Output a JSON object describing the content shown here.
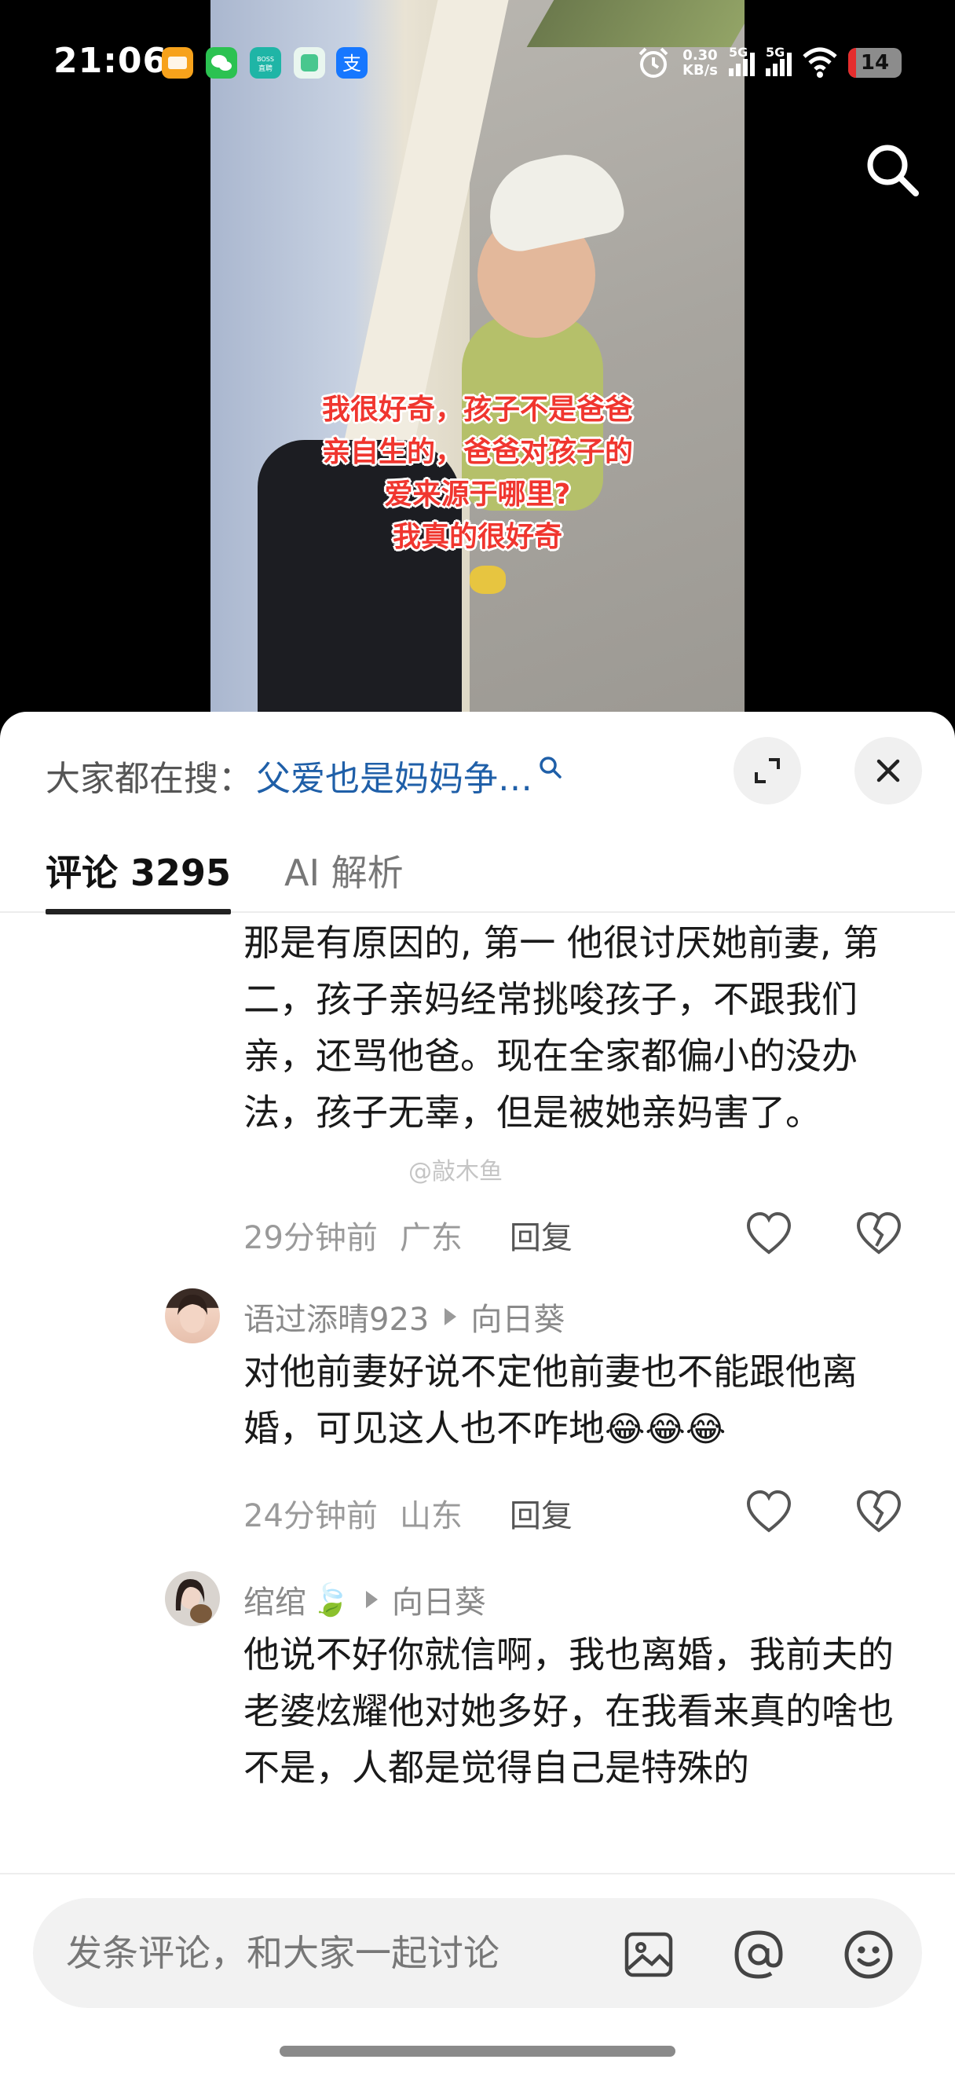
{
  "status_bar": {
    "time": "21:06",
    "net_speed_value": "0.30",
    "net_speed_unit": "KB/s",
    "signal_1_label": "5G",
    "signal_2_label": "5G",
    "battery": "14",
    "app_icons": [
      "orange-app-icon",
      "wechat-icon",
      "boss-zhipin-icon",
      "green-app-icon",
      "alipay-icon"
    ]
  },
  "video": {
    "overlay_lines": [
      "我很好奇，孩子不是爸爸",
      "亲自生的，爸爸对孩子的",
      "爱来源于哪里?",
      "我真的很好奇"
    ]
  },
  "hot_search": {
    "prefix": "大家都在搜：",
    "query": "父爱也是妈妈争…"
  },
  "tabs": {
    "comments": "评论 3295",
    "ai": "AI 解析"
  },
  "watermark": "@敲木鱼",
  "comments": [
    {
      "text": "那是有原因的, 第一 他很讨厌她前妻, 第二，孩子亲妈经常挑唆孩子，不跟我们亲，还骂他爸。现在全家都偏小的没办法，孩子无辜，但是被她亲妈害了。",
      "time": "29分钟前",
      "location": "广东",
      "reply": "回复"
    },
    {
      "user": "语过添晴923",
      "reply_to": "向日葵",
      "text": "对他前妻好说不定他前妻也不能跟他离婚，可见这人也不咋地",
      "emoji": "😂😂😂",
      "time": "24分钟前",
      "location": "山东",
      "reply": "回复"
    },
    {
      "user": "绾绾",
      "user_badge": "🍃",
      "reply_to": "向日葵",
      "text": "他说不好你就信啊，我也离婚，我前夫的老婆炫耀他对她多好，在我看来真的啥也不是，人都是觉得自己是特殊的"
    }
  ],
  "input": {
    "placeholder": "发条评论，和大家一起讨论"
  },
  "colors": {
    "accent_link": "#1f5fa8",
    "overlay_text": "#f0362f",
    "battery_low": "#e52d2d"
  }
}
